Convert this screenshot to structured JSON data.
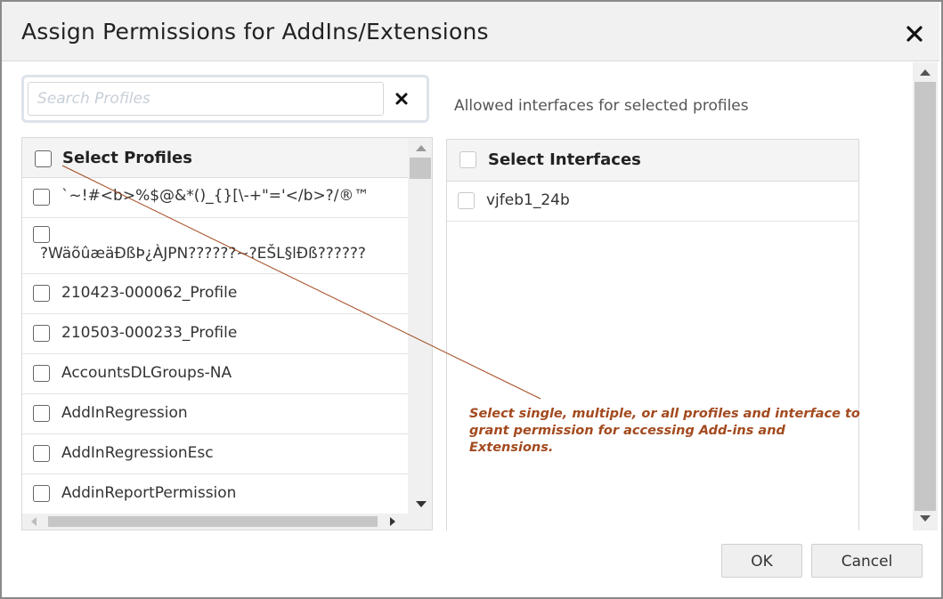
{
  "dialog": {
    "title": "Assign Permissions for AddIns/Extensions"
  },
  "search": {
    "placeholder": "Search Profiles",
    "value": ""
  },
  "profiles": {
    "header_label": "Select Profiles",
    "items": [
      {
        "label": "`~!#<b>%$@&*()_{}[\\-+\"='</b>?/®™"
      },
      {
        "label": "?WäõûæäÐßÞ¿ÀJPN??????~?EŠL§lÐß??????"
      },
      {
        "label": "210423-000062_Profile"
      },
      {
        "label": "210503-000233_Profile"
      },
      {
        "label": "AccountsDLGroups-NA"
      },
      {
        "label": "AddInRegression"
      },
      {
        "label": "AddInRegressionEsc"
      },
      {
        "label": "AddinReportPermission"
      }
    ]
  },
  "interfaces": {
    "section_label": "Allowed interfaces for selected profiles",
    "header_label": "Select Interfaces",
    "items": [
      {
        "label": "vjfeb1_24b"
      }
    ]
  },
  "callout": {
    "text": "Select single, multiple, or all profiles and interface to grant permission for accessing Add-ins and Extensions."
  },
  "buttons": {
    "ok_label": "OK",
    "cancel_label": "Cancel"
  },
  "colors": {
    "callout": "#a34a1f",
    "titlebar": "#f1f1f1"
  }
}
